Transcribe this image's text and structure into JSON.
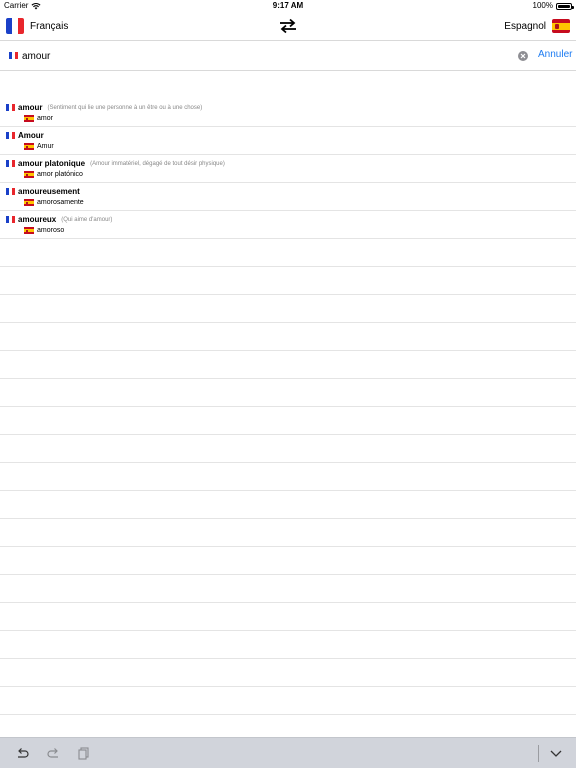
{
  "status": {
    "carrier": "Carrier",
    "time": "9:17 AM",
    "battery": "100%"
  },
  "languages": {
    "source_label": "Français",
    "target_label": "Espagnol",
    "source_flag": "france-flag-icon",
    "target_flag": "spain-flag-icon",
    "swap_icon": "swap-arrows-icon"
  },
  "search": {
    "value": "amour",
    "placeholder": "",
    "cancel_label": "Annuler",
    "clear_icon": "clear-circle-icon"
  },
  "results": [
    {
      "word": "amour",
      "gloss": "(Sentiment qui lie une personne à un être ou à une chose)",
      "translation": "amor"
    },
    {
      "word": "Amour",
      "gloss": "",
      "translation": "Amur"
    },
    {
      "word": "amour platonique",
      "gloss": "(Amour immatériel, dégagé de tout désir physique)",
      "translation": "amor platónico"
    },
    {
      "word": "amoureusement",
      "gloss": "",
      "translation": "amorosamente"
    },
    {
      "word": "amoureux",
      "gloss": "(Qui aime d'amour)",
      "translation": "amoroso"
    }
  ],
  "toolbar": {
    "undo_icon": "undo-icon",
    "redo_icon": "redo-icon",
    "paste_icon": "paste-icon",
    "dismiss_icon": "chevron-down-icon"
  },
  "colors": {
    "accent": "#1e7cf2",
    "france_blue": "#1a40c8",
    "france_red": "#e8262c",
    "spain_red": "#c60b1e",
    "spain_yellow": "#ffc400",
    "keyboard_bar": "#d1d4db"
  }
}
